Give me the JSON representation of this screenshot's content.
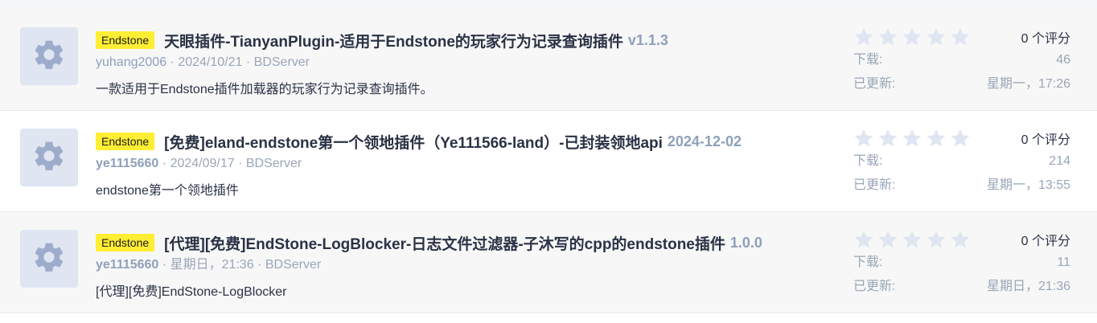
{
  "resources": [
    {
      "prefix": "Endstone",
      "title": "天眼插件-TianyanPlugin-适用于Endstone的玩家行为记录查询插件",
      "version": "v1.1.3",
      "author": "yuhang2006",
      "author_bold": false,
      "date": "2024/10/21",
      "category": "BDServer",
      "description": "一款适用于Endstone插件加载器的玩家行为记录查询插件。",
      "rating_count_label": "0 个评分",
      "downloads_label": "下载:",
      "downloads": "46",
      "updated_label": "已更新:",
      "updated": "星期一，17:26",
      "stars_filled": 0
    },
    {
      "prefix": "Endstone",
      "title": "[免费]eland-endstone第一个领地插件（Ye111566-land）-已封装领地api",
      "version": "2024-12-02",
      "author": "ye1115660",
      "author_bold": true,
      "date": "2024/09/17",
      "category": "BDServer",
      "description": "endstone第一个领地插件",
      "rating_count_label": "0 个评分",
      "downloads_label": "下载:",
      "downloads": "214",
      "updated_label": "已更新:",
      "updated": "星期一，13:55",
      "stars_filled": 0
    },
    {
      "prefix": "Endstone",
      "title": "[代理][免费]EndStone-LogBlocker-日志文件过滤器-子沐写的cpp的endstone插件",
      "version": "1.0.0",
      "author": "ye1115660",
      "author_bold": true,
      "date": "星期日，21:36",
      "category": "BDServer",
      "description": "[代理][免费]EndStone-LogBlocker",
      "rating_count_label": "0 个评分",
      "downloads_label": "下载:",
      "downloads": "11",
      "updated_label": "已更新:",
      "updated": "星期日，21:36",
      "stars_filled": 0
    }
  ],
  "meta_separator": "·",
  "icons": {
    "avatar": "gear-icon",
    "star": "star-icon"
  },
  "colors": {
    "prefix_bg": "#ffee33",
    "title": "#2a3245",
    "muted": "#9aa6b8",
    "star_empty": "#dfe5f1",
    "avatar_bg": "#dfe5f1",
    "gear": "#9daccb"
  }
}
